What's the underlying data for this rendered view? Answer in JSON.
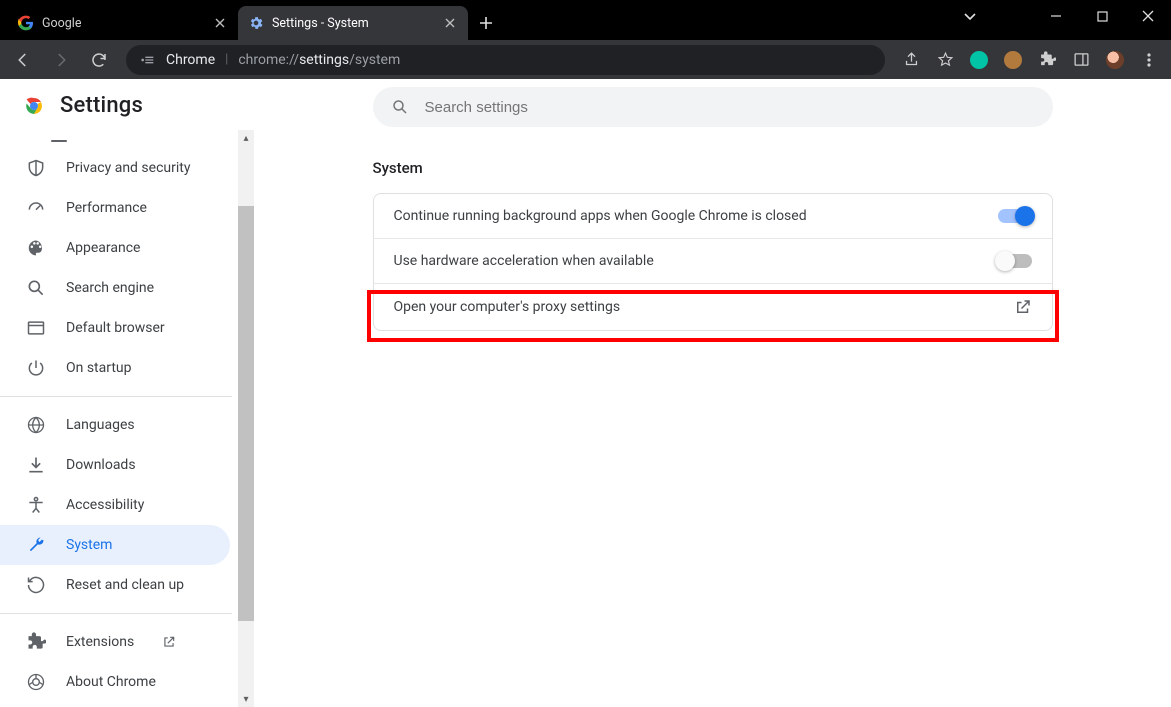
{
  "window": {
    "tabs": [
      {
        "title": "Google",
        "active": false
      },
      {
        "title": "Settings - System",
        "active": true
      }
    ]
  },
  "toolbar": {
    "omnibox_prefix": "Chrome",
    "omnibox_url_plain1": "chrome://",
    "omnibox_url_bold": "settings",
    "omnibox_url_plain2": "/system"
  },
  "settings": {
    "header": "Settings",
    "search_placeholder": "Search settings"
  },
  "sidebar": {
    "items": [
      {
        "label": "Privacy and security"
      },
      {
        "label": "Performance"
      },
      {
        "label": "Appearance"
      },
      {
        "label": "Search engine"
      },
      {
        "label": "Default browser"
      },
      {
        "label": "On startup"
      },
      {
        "label": "Languages"
      },
      {
        "label": "Downloads"
      },
      {
        "label": "Accessibility"
      },
      {
        "label": "System"
      },
      {
        "label": "Reset and clean up"
      },
      {
        "label": "Extensions"
      },
      {
        "label": "About Chrome"
      }
    ]
  },
  "main": {
    "section_title": "System",
    "rows": {
      "bg_apps": {
        "label": "Continue running background apps when Google Chrome is closed",
        "enabled": true
      },
      "hw_accel": {
        "label": "Use hardware acceleration when available",
        "enabled": false
      },
      "proxy": {
        "label": "Open your computer's proxy settings"
      }
    }
  }
}
